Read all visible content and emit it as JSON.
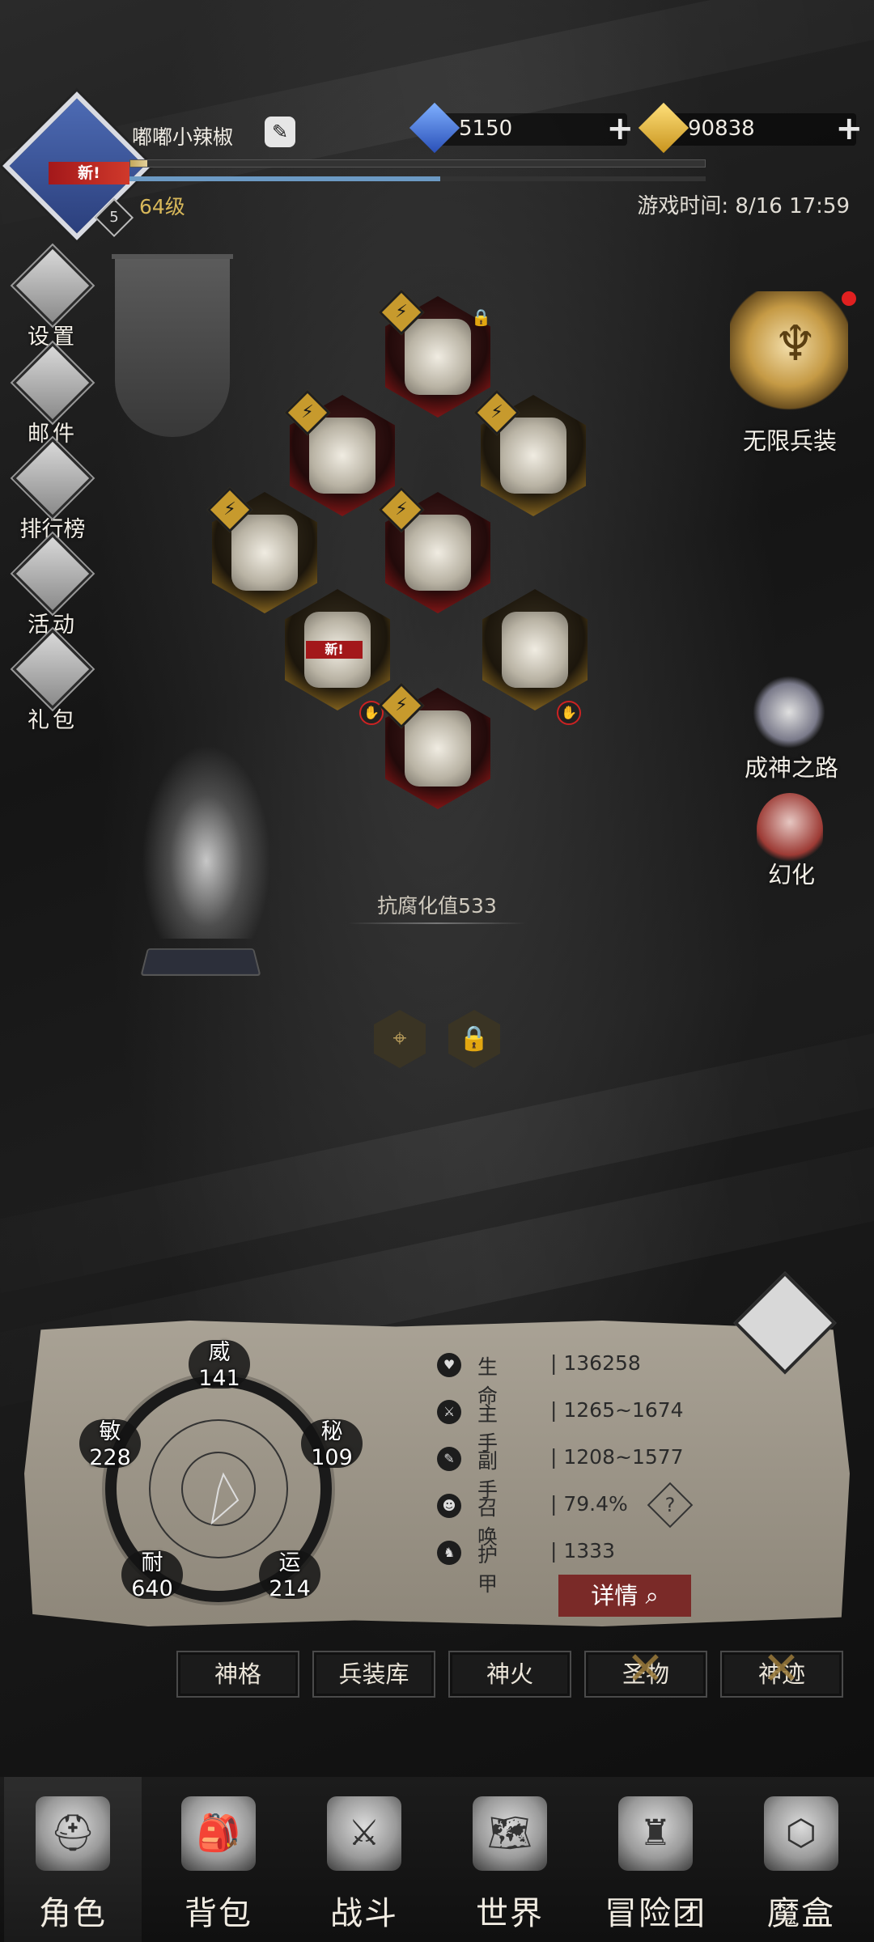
{
  "player": {
    "name": "嘟嘟小辣椒",
    "level": "64级",
    "level_badge": "5",
    "new_tag": "新!",
    "xp_fraction": 0.03,
    "hp_fraction": 0.54
  },
  "currencies": [
    {
      "icon": "blue-gem-icon",
      "value": "5150",
      "color": "#3a6fd8"
    },
    {
      "icon": "gold-gem-icon",
      "value": "90838",
      "color": "#e0b030"
    }
  ],
  "game_time": "游戏时间: 8/16 17:59",
  "left_menu": [
    {
      "icon": "gear-icon",
      "label": "设置"
    },
    {
      "icon": "mail-icon",
      "label": "邮件"
    },
    {
      "icon": "ranking-icon",
      "label": "排行榜"
    },
    {
      "icon": "activity-icon",
      "label": "活动"
    },
    {
      "icon": "gift-icon",
      "label": "礼包"
    }
  ],
  "right_menu": {
    "wuxian": "无限兵装",
    "chengshen": "成神之路",
    "huanhua": "幻化"
  },
  "equipment": {
    "new_tag": "新!",
    "bolt_glyph": "⚡",
    "slots": [
      {
        "name": "helmet",
        "rarity": "red"
      },
      {
        "name": "amulet",
        "rarity": "red"
      },
      {
        "name": "ring",
        "rarity": "gold"
      },
      {
        "name": "belt",
        "rarity": "gold"
      },
      {
        "name": "armor",
        "rarity": "red"
      },
      {
        "name": "main-hand-weapon",
        "rarity": "gold"
      },
      {
        "name": "off-hand-weapon",
        "rarity": "gold"
      },
      {
        "name": "boots",
        "rarity": "red"
      }
    ]
  },
  "resist": "抗腐化值533",
  "attributes": {
    "wei": {
      "label": "威",
      "value": "141"
    },
    "mi": {
      "label": "秘",
      "value": "109"
    },
    "yun": {
      "label": "运",
      "value": "214"
    },
    "nai": {
      "label": "耐",
      "value": "640"
    },
    "min": {
      "label": "敏",
      "value": "228"
    }
  },
  "stats": [
    {
      "icon": "heart-icon",
      "name": "生命",
      "value": "| 136258"
    },
    {
      "icon": "sword-icon",
      "name": "主手",
      "value": "| 1265~1674"
    },
    {
      "icon": "dagger-icon",
      "name": "副手",
      "value": "| 1208~1577"
    },
    {
      "icon": "summon-icon",
      "name": "召唤",
      "value": "| 79.4%"
    },
    {
      "icon": "armor-icon",
      "name": "护甲",
      "value": "| 1333"
    }
  ],
  "stat_help": "?",
  "detail_button": "详情",
  "tabs": [
    {
      "label": "神格",
      "locked": false
    },
    {
      "label": "兵装库",
      "locked": false
    },
    {
      "label": "神火",
      "locked": false
    },
    {
      "label": "圣物",
      "locked": true
    },
    {
      "label": "神迹",
      "locked": true
    }
  ],
  "bottom_nav": [
    {
      "icon": "helmet-icon",
      "label": "角色",
      "active": true
    },
    {
      "icon": "backpack-icon",
      "label": "背包",
      "active": false
    },
    {
      "icon": "shield-sword-icon",
      "label": "战斗",
      "active": false
    },
    {
      "icon": "map-icon",
      "label": "世界",
      "active": false
    },
    {
      "icon": "castle-icon",
      "label": "冒险团",
      "active": false
    },
    {
      "icon": "cube-icon",
      "label": "魔盒",
      "active": false
    }
  ]
}
